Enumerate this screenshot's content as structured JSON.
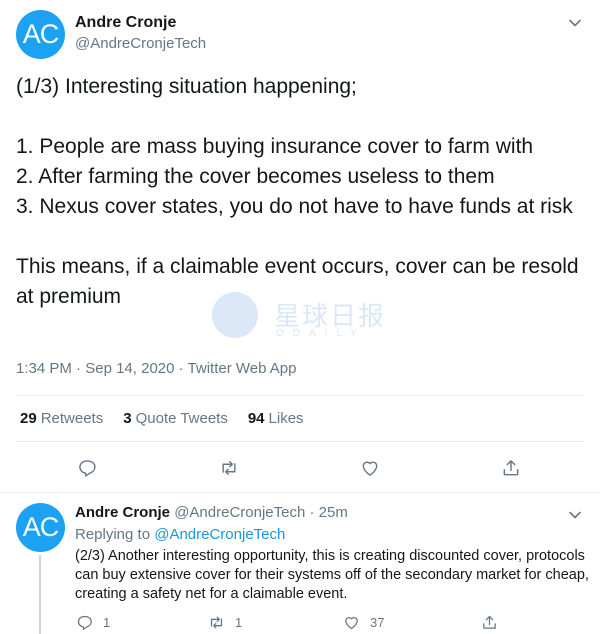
{
  "main_tweet": {
    "avatar_initials": "AC",
    "author_name": "Andre Cronje",
    "author_handle": "@AndreCronjeTech",
    "paragraph_1": "(1/3) Interesting situation happening;",
    "paragraph_2": "1. People are mass buying insurance cover to farm with\n2. After farming the cover becomes useless to them\n3. Nexus cover states, you do not have to have funds at risk",
    "paragraph_3": "This means, if a claimable event occurs, cover can be resold at premium",
    "time": "1:34 PM",
    "date": "Sep 14, 2020",
    "source": "Twitter Web App",
    "stats": {
      "retweets_count": "29",
      "retweets_label": "Retweets",
      "quote_count": "3",
      "quote_label": "Quote Tweets",
      "likes_count": "94",
      "likes_label": "Likes"
    }
  },
  "watermark": {
    "cn_text": "星球日报",
    "en_text": "ODAILY"
  },
  "reply_tweet": {
    "avatar_initials": "AC",
    "author_name": "Andre Cronje",
    "author_handle": "@AndreCronjeTech",
    "age": "25m",
    "replying_prefix": "Replying to",
    "replying_handle": "@AndreCronjeTech",
    "text": "(2/3) Another interesting opportunity, this is creating discounted cover, protocols can buy extensive cover for their systems off of the secondary market for cheap, creating a safety net for a claimable event.",
    "reply_count": "1",
    "retweet_count": "1",
    "like_count": "37"
  },
  "icons": {
    "reply": "reply-icon",
    "retweet": "retweet-icon",
    "like": "heart-icon",
    "share": "share-icon",
    "menu": "chevron-down-icon"
  },
  "colors": {
    "accent": "#1da1f2",
    "link": "#1b95e0",
    "secondary_text": "#657786",
    "primary_text": "#14171a"
  }
}
